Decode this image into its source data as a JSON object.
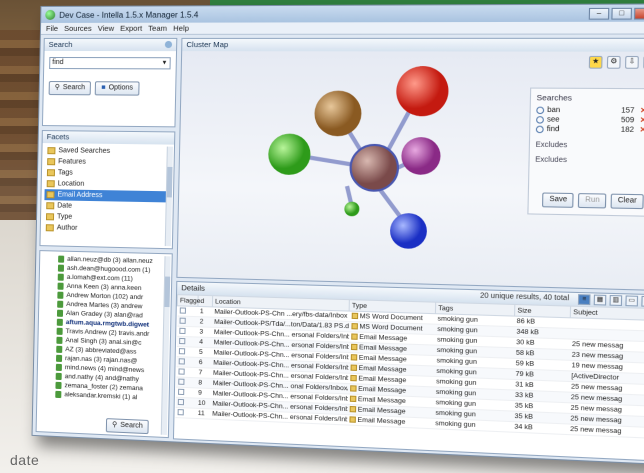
{
  "window": {
    "title": "Dev Case - Intella 1.5.x Manager 1.5.4",
    "controls": [
      "–",
      "□",
      "✕"
    ]
  },
  "menu": [
    "File",
    "Sources",
    "View",
    "Export",
    "Team",
    "Help"
  ],
  "search_panel": {
    "title": "Search",
    "query_value": "find",
    "search_button": "Search",
    "options_button": "Options"
  },
  "facets_panel": {
    "title": "Facets",
    "items": [
      {
        "label": "Saved Searches",
        "selected": false
      },
      {
        "label": "Features",
        "selected": false
      },
      {
        "label": "Tags",
        "selected": false
      },
      {
        "label": "Location",
        "selected": false
      },
      {
        "label": "Email Address",
        "selected": true
      },
      {
        "label": "Date",
        "selected": false
      },
      {
        "label": "Type",
        "selected": false
      },
      {
        "label": "Author",
        "selected": false
      }
    ]
  },
  "tree_items": [
    "allan.neuz@db (3)  allan.neuz",
    "ash.dean@hugoood.com (1)",
    "a.lomah@ext.com (11)",
    "Anna Keen (3)  anna.keen",
    "Andrew Morton (102)  andr",
    "Andrea Martes (3)  andrew",
    "Alan Gradey (3)  alan@rad",
    "aftum.aqua.rmgtwb.digwet",
    "Travis Andrew (2)  travis.andr",
    "Anal Singh (3)  anal.sin@c",
    "AZ (3)  abbreviated@ass",
    "rajan.nas (3)  rajan.nas@",
    "mind.news (4)  mind@news",
    "and.nathy (4)  and@nathy",
    "zemana_foster (2)  zemana",
    "aleksandar.kremski (1)  al"
  ],
  "tree_search_button": "Search",
  "outer_panel": {
    "title": "Cluster Map"
  },
  "searches_box": {
    "title": "Searches",
    "rows": [
      {
        "term": "ban",
        "count": "157"
      },
      {
        "term": "see",
        "count": "509"
      },
      {
        "term": "find",
        "count": "182"
      }
    ],
    "excludes_label": "Excludes",
    "excludes2_label": "Excludes",
    "buttons": [
      "Save",
      "Run",
      "Clear"
    ]
  },
  "details": {
    "title": "Details",
    "result_count": "20 unique results, 40 total",
    "columns": [
      "Flagged",
      "",
      "Location",
      "Type",
      "Tags",
      "Size",
      "Subject"
    ],
    "rows": [
      {
        "n": "1",
        "loc": "Mailer-Outlook-PS-Chn ...ery/fbs-data/Inbox",
        "type": "MS Word Document",
        "tags": "smoking gun",
        "size": "86 kB",
        "subj": ""
      },
      {
        "n": "2",
        "loc": "Mailer-Outlook-PS/Tda/...ton/Data/1.83 PS.dat",
        "type": "MS Word Document",
        "tags": "smoking gun",
        "size": "348 kB",
        "subj": ""
      },
      {
        "n": "3",
        "loc": "Mailer-Outlook-PS-Chn... ersonal Folders/Inbox",
        "type": "Email Message",
        "tags": "smoking gun",
        "size": "30 kB",
        "subj": "25 new messag"
      },
      {
        "n": "4",
        "loc": "Mailer-Outlook-PS-Chn... ersonal Folders/Inbox",
        "type": "Email Message",
        "tags": "smoking gun",
        "size": "58 kB",
        "subj": "23 new messag"
      },
      {
        "n": "5",
        "loc": "Mailer-Outlook-PS-Chn... ersonal Folders/Inbox",
        "type": "Email Message",
        "tags": "smoking gun",
        "size": "59 kB",
        "subj": "19 new messag"
      },
      {
        "n": "6",
        "loc": "Mailer-Outlook-PS-Chn... ersonal Folders/Inbox",
        "type": "Email Message",
        "tags": "smoking gun",
        "size": "79 kB",
        "subj": "[ActiveDirector"
      },
      {
        "n": "7",
        "loc": "Mailer-Outlook-PS-Chn... ersonal Folders/Inbox",
        "type": "Email Message",
        "tags": "smoking gun",
        "size": "31 kB",
        "subj": "25 new messag"
      },
      {
        "n": "8",
        "loc": "Mailer-Outlook-PS-Chn... onal Folders/Inbox/jeff",
        "type": "Email Message",
        "tags": "smoking gun",
        "size": "33 kB",
        "subj": "25 new messag"
      },
      {
        "n": "9",
        "loc": "Mailer-Outlook-PS-Chn... ersonal Folders/Inbox",
        "type": "Email Message",
        "tags": "smoking gun",
        "size": "35 kB",
        "subj": "25 new messag"
      },
      {
        "n": "10",
        "loc": "Mailer-Outlook-PS-Chn... ersonal Folders/Inbox",
        "type": "Email Message",
        "tags": "smoking gun",
        "size": "35 kB",
        "subj": "25 new messag"
      },
      {
        "n": "11",
        "loc": "Mailer-Outlook-PS-Chn... ersonal Folders/Inbox",
        "type": "Email Message",
        "tags": "smoking gun",
        "size": "34 kB",
        "subj": "25 new messag"
      }
    ]
  },
  "caption": "date",
  "colors": {
    "accent_green": "#2f7f3e",
    "selection_blue": "#3f83d6"
  }
}
